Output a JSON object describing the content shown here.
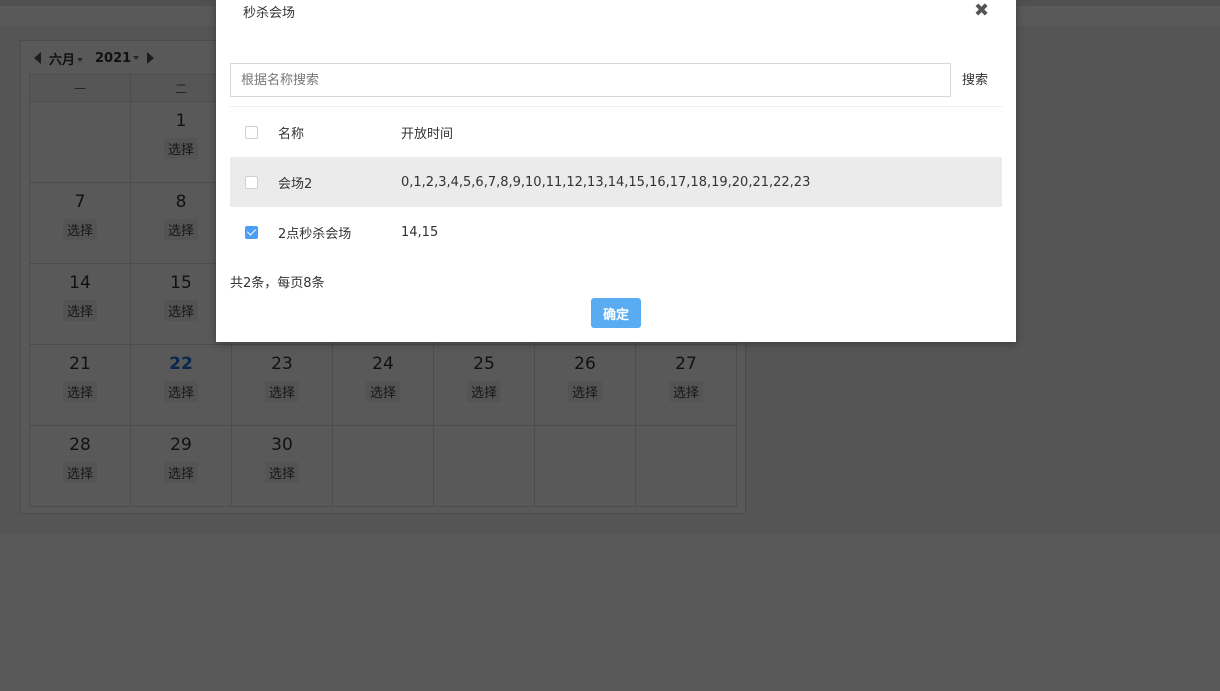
{
  "calendar": {
    "month_label": "六月",
    "year_label": "2021",
    "weekday_headers": [
      "一",
      "二",
      "",
      "",
      "",
      "",
      ""
    ],
    "pick_label": "选择",
    "weeks": [
      [
        "",
        "1",
        "",
        "",
        "",
        "",
        ""
      ],
      [
        "7",
        "8",
        "",
        "",
        "",
        "",
        ""
      ],
      [
        "14",
        "15",
        "",
        "",
        "",
        "",
        ""
      ],
      [
        "21",
        "22",
        "23",
        "24",
        "25",
        "26",
        "27"
      ],
      [
        "28",
        "29",
        "30",
        "",
        "",
        "",
        ""
      ]
    ],
    "today": "22"
  },
  "modal": {
    "title": "秒杀会场",
    "close_symbol": "✖",
    "search_placeholder": "根据名称搜索",
    "search_label": "搜索",
    "columns": {
      "name": "名称",
      "time": "开放时间"
    },
    "rows": [
      {
        "name": "会场2",
        "time": "0,1,2,3,4,5,6,7,8,9,10,11,12,13,14,15,16,17,18,19,20,21,22,23",
        "checked": false
      },
      {
        "name": "2点秒杀会场",
        "time": "14,15",
        "checked": true
      }
    ],
    "pager_text": "共2条，每页8条",
    "confirm_label": "确定"
  }
}
